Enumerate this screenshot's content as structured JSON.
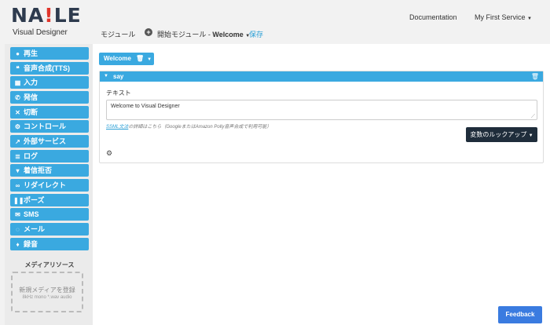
{
  "header": {
    "logo_prefix": "NA",
    "logo_bang": "!",
    "logo_suffix": "LE",
    "subtitle": "Visual Designer",
    "module_label": "モジュール",
    "crumb_prefix": "開始モジュール - ",
    "crumb_current": "Welcome",
    "save_label": "保存",
    "documentation": "Documentation",
    "service": "My First Service"
  },
  "sidebar": {
    "items": [
      {
        "icon": "play-icon",
        "glyph": "●",
        "label": "再生"
      },
      {
        "icon": "quote-icon",
        "glyph": "❝",
        "label": "音声合成(TTS)"
      },
      {
        "icon": "keypad-icon",
        "glyph": "▦",
        "label": "入力"
      },
      {
        "icon": "phone-icon",
        "glyph": "✆",
        "label": "発信"
      },
      {
        "icon": "close-icon",
        "glyph": "✕",
        "label": "切断"
      },
      {
        "icon": "gears-icon",
        "glyph": "⚙",
        "label": "コントロール"
      },
      {
        "icon": "external-link-icon",
        "glyph": "↗",
        "label": "外部サービス"
      },
      {
        "icon": "list-icon",
        "glyph": "≣",
        "label": "ログ"
      },
      {
        "icon": "thumbs-down-icon",
        "glyph": "▾",
        "label": "着信拒否"
      },
      {
        "icon": "link-icon",
        "glyph": "∞",
        "label": "リダイレクト"
      },
      {
        "icon": "pause-icon",
        "glyph": "❚❚",
        "label": "ポーズ"
      },
      {
        "icon": "envelope-icon",
        "glyph": "✉",
        "label": "SMS"
      },
      {
        "icon": "speech-bubble-icon",
        "glyph": "◌",
        "label": "メール"
      },
      {
        "icon": "microphone-icon",
        "glyph": "♦",
        "label": "録音"
      }
    ],
    "media_title": "メディアリソース",
    "media_drop_label": "新規メディアを登録",
    "media_drop_hint": "8kHz mono *.wav audio"
  },
  "main": {
    "tab_label": "Welcome",
    "panel_title": "say",
    "field_label": "テキスト",
    "text_value": "Welcome to Visual Designer",
    "help_link": "SSML文法",
    "help_text": "の詳細はこちら（GoogleまたはAmazon Polly音声合成で利用可能）",
    "lookup_label": "変数のルックアップ"
  },
  "feedback_label": "Feedback",
  "colors": {
    "accent": "#3aa9e0",
    "dark_button": "#1f2d3b",
    "feedback": "#3a7be0",
    "logo_bang": "#e0352b"
  }
}
